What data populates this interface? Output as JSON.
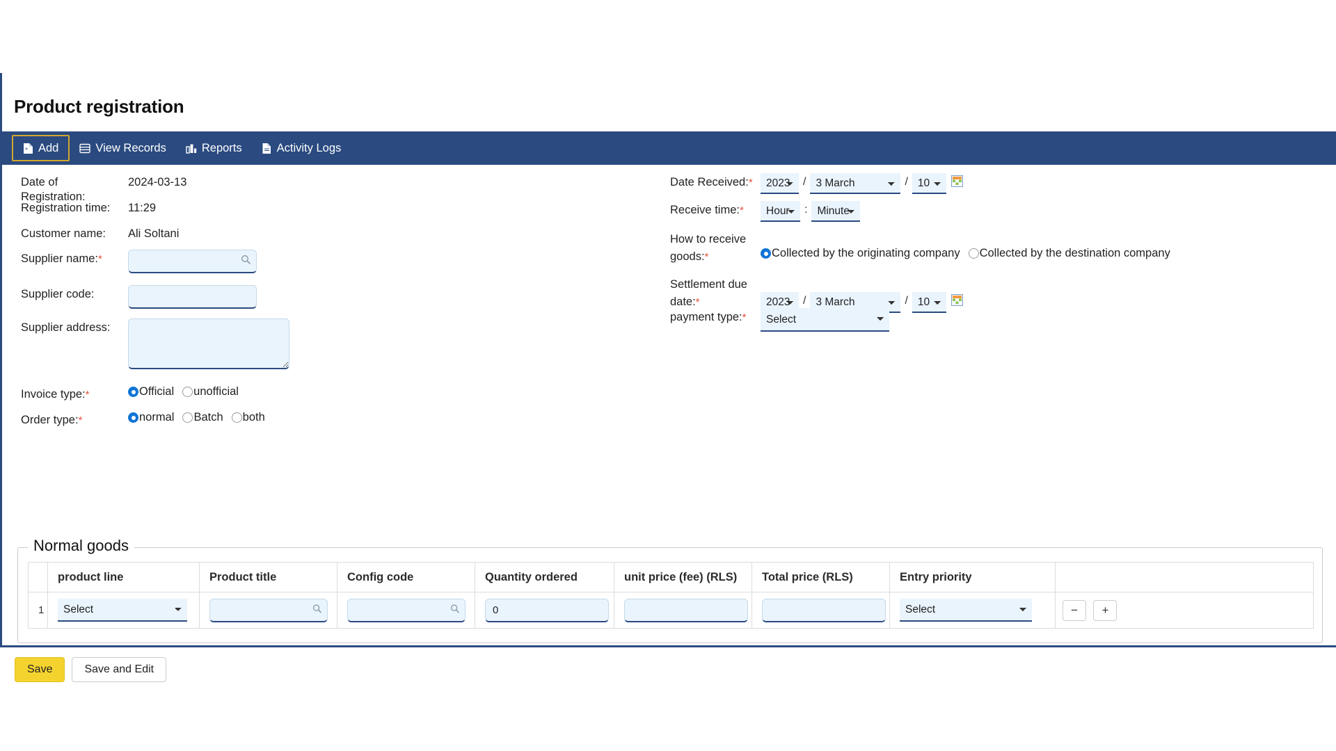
{
  "page": {
    "title": "Product registration"
  },
  "nav": {
    "tabs": [
      {
        "label": "Add",
        "icon": "file-add-icon",
        "active": true
      },
      {
        "label": "View Records",
        "icon": "list-icon",
        "active": false
      },
      {
        "label": "Reports",
        "icon": "bar-chart-icon",
        "active": false
      },
      {
        "label": "Activity Logs",
        "icon": "document-icon",
        "active": false
      }
    ]
  },
  "left_form": {
    "date_of_registration": {
      "label": "Date of Registration:",
      "value": "2024-03-13"
    },
    "registration_time": {
      "label": "Registration time:",
      "value": "11:29"
    },
    "customer_name": {
      "label": "Customer name:",
      "value": "Ali Soltani"
    },
    "supplier_name": {
      "label": "Supplier name:",
      "required": true,
      "value": "",
      "icon": "search-icon"
    },
    "supplier_code": {
      "label": "Supplier code:",
      "required": false,
      "value": ""
    },
    "supplier_address": {
      "label": "Supplier address:",
      "required": false,
      "value": ""
    },
    "invoice_type": {
      "label": "Invoice type:",
      "required": true,
      "options": [
        {
          "label": "Official",
          "selected": true
        },
        {
          "label": "unofficial",
          "selected": false
        }
      ]
    },
    "order_type": {
      "label": "Order type:",
      "required": true,
      "options": [
        {
          "label": "normal",
          "selected": true
        },
        {
          "label": "Batch",
          "selected": false
        },
        {
          "label": "both",
          "selected": false
        }
      ]
    }
  },
  "right_form": {
    "date_received": {
      "label": "Date Received:",
      "required": true,
      "year": "2023",
      "month": "3 March",
      "day": "10",
      "icon": "calendar-icon"
    },
    "receive_time": {
      "label": "Receive time:",
      "required": true,
      "hour": "Hour",
      "minute": "Minute",
      "separator": ":"
    },
    "how_to_receive_goods": {
      "label_line1": "How to receive",
      "label_line2": "goods:",
      "required": true,
      "options": [
        {
          "label": "Collected by the originating company",
          "selected": true
        },
        {
          "label": "Collected by the destination company",
          "selected": false
        }
      ]
    },
    "settlement_due_date": {
      "label_line1": "Settlement due",
      "label_line2": "date:",
      "required": true,
      "year": "2023",
      "month": "3 March",
      "day": "10",
      "icon": "calendar-icon"
    },
    "payment_type": {
      "label": "payment type:",
      "required": true,
      "value": "Select"
    }
  },
  "goods_section": {
    "legend": "Normal goods",
    "columns": [
      "product line",
      "Product title",
      "Config code",
      "Quantity ordered",
      "unit price (fee) (RLS)",
      "Total price (RLS)",
      "Entry priority"
    ],
    "rows": [
      {
        "index": "1",
        "product_line": "Select",
        "product_title": "",
        "config_code": "",
        "quantity_ordered": "0",
        "unit_price": "",
        "total_price": "",
        "entry_priority": "Select",
        "remove_label": "−",
        "add_label": "+"
      }
    ]
  },
  "footer": {
    "save_label": "Save",
    "save_and_edit_label": "Save and Edit"
  },
  "colors": {
    "navbar": "#2a4a80",
    "active_tab_border": "#d4a62a",
    "save_button": "#f5d32e",
    "input_bg": "#eaf4fd",
    "radio_selected": "#1175d6",
    "required_star": "#e8503a"
  }
}
